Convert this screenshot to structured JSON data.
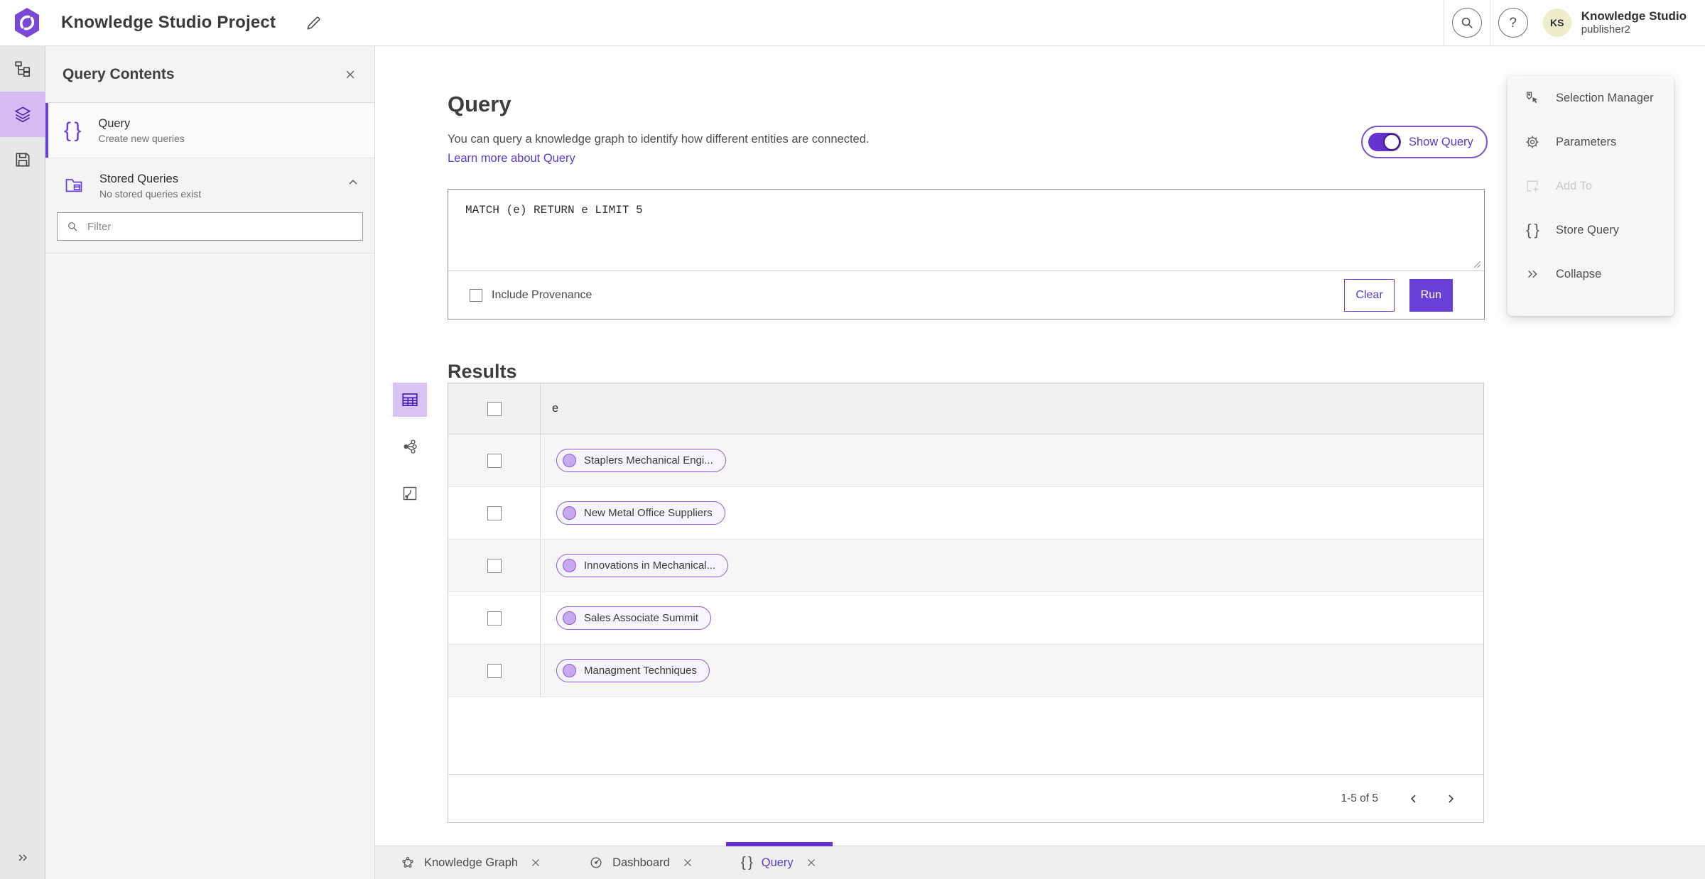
{
  "colors": {
    "accent": "#6b3fd9",
    "accent_dark": "#6633cc",
    "selected_icon_bg": "#d5bdf3",
    "pill_bg": "#f7f4fd",
    "pill_border": "#8a5ad7",
    "panel_bg": "#f4f4f4",
    "sidebar_bg": "#e7e7e7",
    "avatar_bg": "#eeeccb",
    "run_button_bg": "#6b40d9"
  },
  "header": {
    "title": "Knowledge Studio Project",
    "app_name": "Knowledge Studio",
    "username": "publisher2",
    "avatar_initials": "KS"
  },
  "nav_sidebar": {
    "items": [
      {
        "icon": "data-model-icon",
        "selected": false
      },
      {
        "icon": "layers-icon",
        "selected": true
      },
      {
        "icon": "save-icon",
        "selected": false
      }
    ],
    "expand_icon": "double-chevron-right-icon"
  },
  "contents_panel": {
    "title": "Query Contents",
    "query_item": {
      "title": "Query",
      "subtitle": "Create new queries"
    },
    "stored_queries": {
      "title": "Stored Queries",
      "subtitle": "No stored queries exist"
    },
    "filter_placeholder": "Filter"
  },
  "query_section": {
    "title": "Query",
    "description": "You can query a knowledge graph to identify how different entities are connected.",
    "learn_more": "Learn more about Query",
    "show_query_label": "Show Query",
    "show_query_on": true,
    "query_text": "MATCH (e) RETURN e LIMIT 5",
    "include_provenance_label": "Include Provenance",
    "include_provenance_checked": false,
    "clear_label": "Clear",
    "run_label": "Run"
  },
  "results": {
    "title": "Results",
    "views": [
      "table-view",
      "link-chart-view",
      "map-view"
    ],
    "active_view": "table-view",
    "column_header": "e",
    "rows": [
      "Staplers Mechanical Engi...",
      "New Metal Office Suppliers",
      "Innovations in Mechanical...",
      "Sales Associate Summit",
      "Managment Techniques"
    ],
    "pagination": {
      "range_label": "1-5 of 5"
    }
  },
  "actions_panel": {
    "items": [
      {
        "label": "Selection Manager",
        "icon": "selection-manager-icon",
        "disabled": false
      },
      {
        "label": "Parameters",
        "icon": "parameters-gear-icon",
        "disabled": false
      },
      {
        "label": "Add To",
        "icon": "add-to-icon",
        "disabled": true
      },
      {
        "label": "Store Query",
        "icon": "store-query-braces-icon",
        "disabled": false
      },
      {
        "label": "Collapse",
        "icon": "collapse-chevrons-icon",
        "disabled": false
      }
    ]
  },
  "tab_bar": {
    "tabs": [
      {
        "label": "Knowledge Graph",
        "icon": "knowledge-graph-icon",
        "active": false
      },
      {
        "label": "Dashboard",
        "icon": "dashboard-icon",
        "active": false
      },
      {
        "label": "Query",
        "icon": "query-braces-icon",
        "active": true
      }
    ]
  },
  "glyphs": {
    "braces": "{ }",
    "question": "?"
  }
}
